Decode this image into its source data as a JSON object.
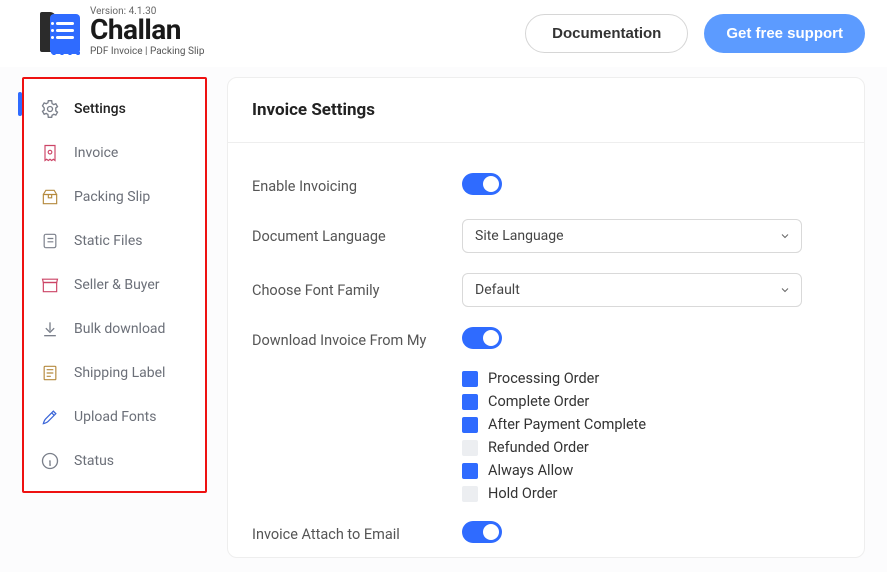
{
  "header": {
    "version": "Version: 4.1.30",
    "brand": "Challan",
    "tagline": "PDF Invoice | Packing Slip",
    "doc_btn": "Documentation",
    "support_btn": "Get free support"
  },
  "sidebar": [
    {
      "label": "Settings"
    },
    {
      "label": "Invoice"
    },
    {
      "label": "Packing Slip"
    },
    {
      "label": "Static Files"
    },
    {
      "label": "Seller & Buyer"
    },
    {
      "label": "Bulk download"
    },
    {
      "label": "Shipping Label"
    },
    {
      "label": "Upload Fonts"
    },
    {
      "label": "Status"
    }
  ],
  "main": {
    "title": "Invoice Settings",
    "rows": {
      "enable": "Enable Invoicing",
      "lang": "Document Language",
      "lang_value": "Site Language",
      "font": "Choose Font Family",
      "font_value": "Default",
      "download": "Download Invoice From My",
      "attach": "Invoice Attach to Email"
    },
    "checks": [
      {
        "checked": true,
        "label": "Processing Order"
      },
      {
        "checked": true,
        "label": "Complete Order"
      },
      {
        "checked": true,
        "label": "After Payment Complete"
      },
      {
        "checked": false,
        "label": "Refunded Order"
      },
      {
        "checked": true,
        "label": "Always Allow"
      },
      {
        "checked": false,
        "label": "Hold Order"
      }
    ]
  }
}
